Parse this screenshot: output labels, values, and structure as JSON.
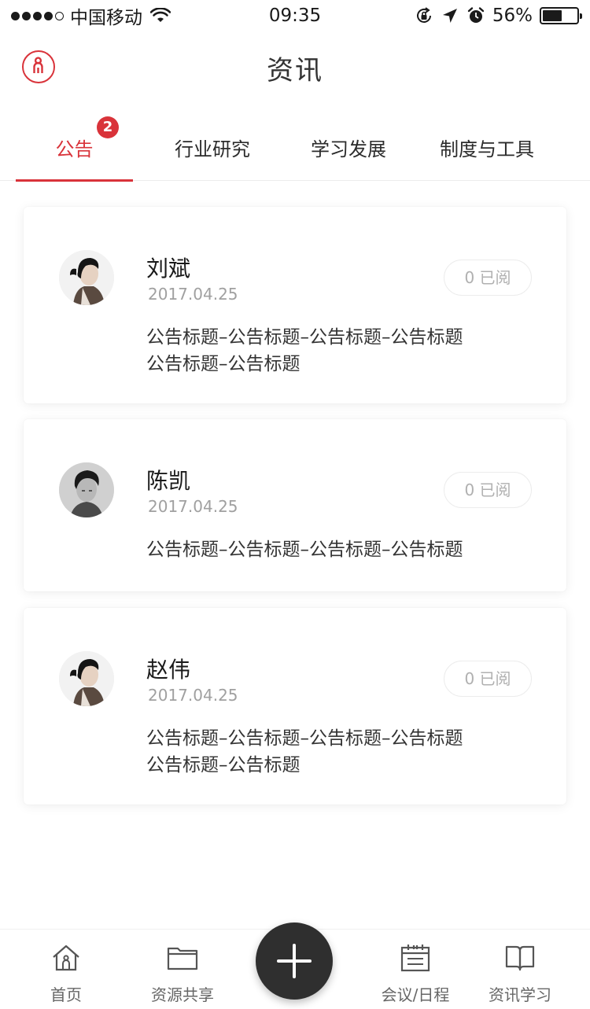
{
  "status_bar": {
    "carrier": "中国移动",
    "time": "09:35",
    "battery_percent": "56%",
    "battery_level": 0.56,
    "icons": [
      "signal-dots-icon",
      "wifi-icon",
      "rotation-lock-icon",
      "location-arrow-icon",
      "alarm-icon",
      "battery-icon"
    ]
  },
  "header": {
    "title": "资讯",
    "profile_icon": "person-icon",
    "accent_color": "#d9333a"
  },
  "tabs": [
    {
      "label": "公告",
      "active": true,
      "badge": "2"
    },
    {
      "label": "行业研究",
      "active": false
    },
    {
      "label": "学习发展",
      "active": false
    },
    {
      "label": "制度与工具",
      "active": false
    }
  ],
  "cards": [
    {
      "author": "刘斌",
      "date": "2017.04.25",
      "read_label": "0 已阅",
      "body_lines": [
        "公告标题–公告标题–公告标题–公告标题",
        "公告标题–公告标题"
      ]
    },
    {
      "author": "陈凯",
      "date": "2017.04.25",
      "read_label": "0 已阅",
      "body_lines": [
        "公告标题–公告标题–公告标题–公告标题"
      ]
    },
    {
      "author": "赵伟",
      "date": "2017.04.25",
      "read_label": "0 已阅",
      "body_lines": [
        "公告标题–公告标题–公告标题–公告标题",
        "公告标题–公告标题"
      ]
    }
  ],
  "bottom_nav": {
    "items": [
      {
        "label": "首页",
        "icon": "home-icon"
      },
      {
        "label": "资源共享",
        "icon": "folder-icon"
      },
      {
        "label": "会议/日程",
        "icon": "calendar-icon"
      },
      {
        "label": "资讯学习",
        "icon": "book-icon"
      }
    ],
    "fab_icon": "plus-icon"
  }
}
